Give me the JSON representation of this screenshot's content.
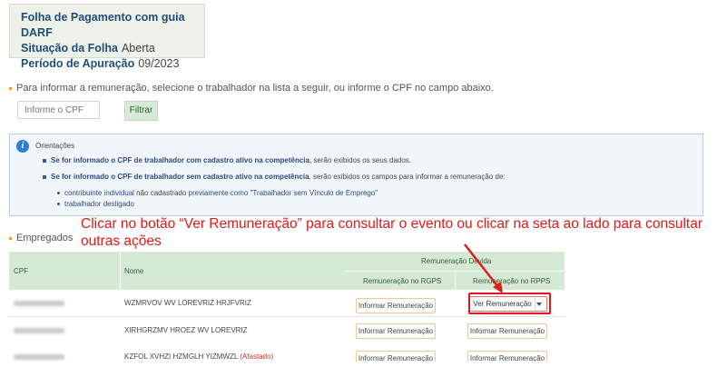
{
  "summary": {
    "title": "Folha de Pagamento com guia DARF",
    "situacao_label": "Situação da Folha",
    "situacao_value": "Aberta",
    "periodo_label": "Período de Apuração",
    "periodo_value": "09/2023"
  },
  "search": {
    "instruction": "Para informar a remuneração, selecione o trabalhador na lista a seguir, ou informe o CPF no campo abaixo.",
    "placeholder": "Informe o CPF",
    "button": "Filtrar"
  },
  "orientacoes": {
    "title": "Orientações",
    "line1_bold": "Se for informado o CPF de trabalhador com cadastro ativo na competência",
    "line1_rest": ", serão exibidos os seus dados.",
    "line2_bold": "Se for informado o CPF de trabalhador sem cadastro ativo na competência",
    "line2_rest": ", serão exibidos os campos para informar a remuneração de:",
    "sub1_a": "contribuinte individual",
    "sub1_b": " não cadastrado ",
    "sub1_c": "previamente como \"Trabalhador sem Vínculo de Emprego\"",
    "sub2": "trabalhador desligado"
  },
  "callout": "Clicar no botão “Ver Remuneração” para consultar o evento ou clicar na seta ao lado para consultar outras ações",
  "empregados": {
    "title": "Empregados",
    "headers": {
      "cpf": "CPF",
      "nome": "Nome",
      "remuneracao_devida": "Remuneração Devida",
      "rgps": "Remuneração no RGPS",
      "rpps": "Remuneração no RPPS"
    },
    "rows": [
      {
        "nome": "WZMRVOV WV LOREVRIZ HRJFVRIZ",
        "afastado": "",
        "rgps_btn": "Informar Remuneração",
        "rpps_btn": "Ver Remuneração"
      },
      {
        "nome": "XIRHGRZMV HROEZ WV LOREVRIZ",
        "afastado": "",
        "rgps_btn": "Informar Remuneração",
        "rpps_btn": "Informar Remuneração"
      },
      {
        "nome": "KZFOL XVHZI HZMGLH YIZMWZL",
        "afastado": "(Afastado)",
        "rgps_btn": "Informar Remuneração",
        "rpps_btn": "Informar Remuneração"
      }
    ]
  },
  "colors": {
    "header_green": "#d4ead5",
    "accent_orange": "#f0a020",
    "callout_red": "#e01919",
    "info_blue": "#2d7fd1"
  }
}
